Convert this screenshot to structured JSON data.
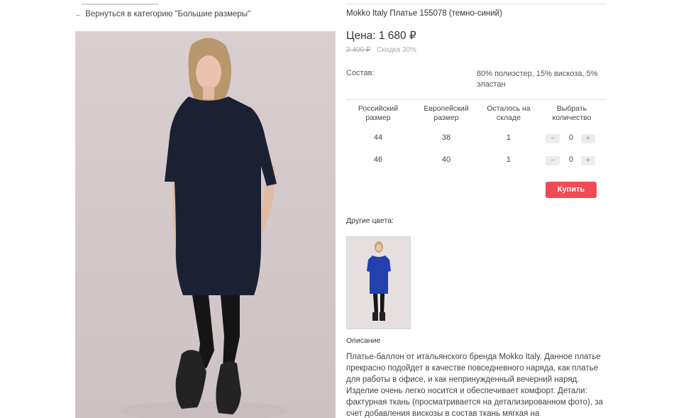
{
  "nav": {
    "back_arrow": "←",
    "back_label": "Вернуться в категорию \"Большие размеры\""
  },
  "product": {
    "title": "Mokko Italy Платье 155078 (темно-синий)",
    "price": "Цена: 1 680 ₽",
    "old_price": "2 400 ₽",
    "discount": "Скидка 30%",
    "composition_label": "Состав:",
    "composition_value": "80% полиэстер, 15% вискоза, 5% эластан",
    "dress_color": "#1c2033"
  },
  "sizes_table": {
    "headers": [
      "Российский размер",
      "Европейский размер",
      "Осталось на складе",
      "Выбрать количество"
    ],
    "rows": [
      {
        "ru": "44",
        "eu": "38",
        "stock": "1",
        "qty": "0"
      },
      {
        "ru": "46",
        "eu": "40",
        "stock": "1",
        "qty": "0"
      }
    ],
    "minus": "−",
    "plus": "+"
  },
  "buy_label": "Купить",
  "other_colors": {
    "label": "Другие цвета:",
    "thumb_dress_color": "#2340b0"
  },
  "description": {
    "heading": "Описание",
    "text": "Платье-баллон от итальянского бренда Mokko Italy. Данное платье прекрасно подойдет в качестве повседневного наряда, как платье для работы в офисе, и как непринужденный вечерний наряд. Изделие очень легко носится и обеспечивает комфорт. Детали: фактурная ткань (просматривается на детализированном фото), за счет добавления вискозы в состав ткань мягкая на"
  },
  "accent_color": "#f04a55"
}
